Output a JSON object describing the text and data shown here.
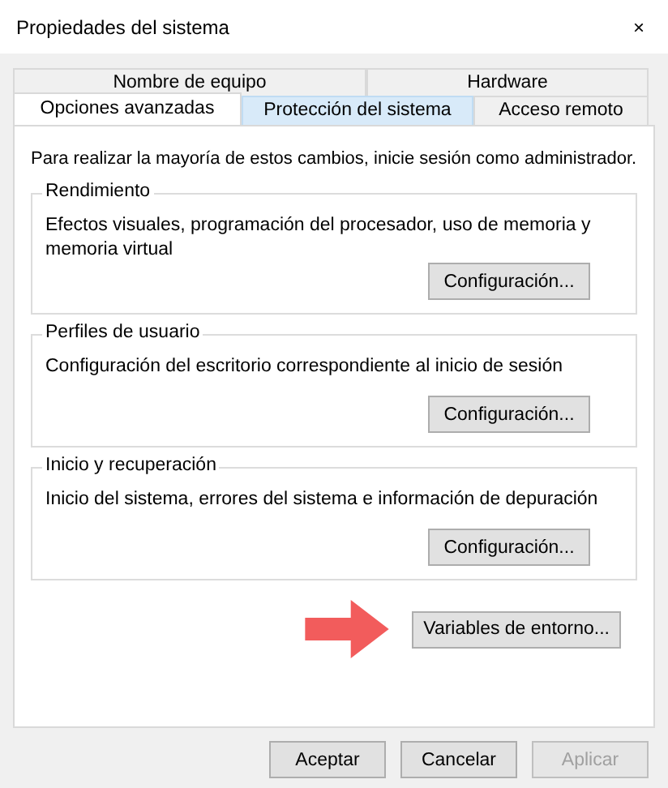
{
  "window": {
    "title": "Propiedades del sistema",
    "close": "×"
  },
  "tab_rows": [
    [
      {
        "label": "Nombre de equipo",
        "selected": false,
        "hovered": false
      },
      {
        "label": "Hardware",
        "selected": false,
        "hovered": false
      }
    ],
    [
      {
        "label": "Opciones avanzadas",
        "selected": true,
        "hovered": false
      },
      {
        "label": "Protección del sistema",
        "selected": false,
        "hovered": true
      },
      {
        "label": "Acceso remoto",
        "selected": false,
        "hovered": false
      }
    ]
  ],
  "notice": "Para realizar la mayoría de estos cambios, inicie sesión como administrador.",
  "groups": [
    {
      "title": "Rendimiento",
      "description": "Efectos visuales, programación del procesador, uso de memoria y memoria virtual",
      "button": "Configuración..."
    },
    {
      "title": "Perfiles de usuario",
      "description": "Configuración del escritorio correspondiente al inicio de sesión",
      "button": "Configuración..."
    },
    {
      "title": "Inicio y recuperación",
      "description": "Inicio del sistema, errores del sistema e información de depuración",
      "button": "Configuración..."
    }
  ],
  "env_button": {
    "label": "Variables de entorno...",
    "annotated": true
  },
  "buttons": [
    {
      "label": "Aceptar",
      "disabled": false
    },
    {
      "label": "Cancelar",
      "disabled": false
    },
    {
      "label": "Aplicar",
      "disabled": true
    }
  ]
}
